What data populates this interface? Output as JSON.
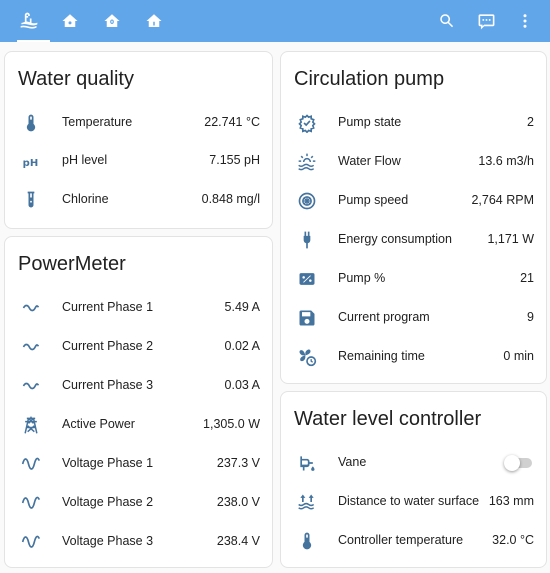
{
  "colors": {
    "header": "#62a6ea",
    "icon": "#44739e",
    "card_bg": "#ffffff",
    "page_bg": "#fafafa"
  },
  "header": {
    "tabs": [
      {
        "icon": "pool-icon",
        "active": true
      },
      {
        "icon": "home-icon",
        "active": false
      },
      {
        "icon": "home-circle-icon",
        "active": false
      },
      {
        "icon": "home-outline-icon",
        "active": false
      }
    ],
    "actions": [
      "search-icon",
      "assist-icon",
      "menu-icon"
    ]
  },
  "water_quality": {
    "title": "Water quality",
    "rows": [
      {
        "icon": "thermometer-icon",
        "label": "Temperature",
        "value": "22.741 °C"
      },
      {
        "icon": "ph-icon",
        "label": "pH level",
        "value": "7.155 pH"
      },
      {
        "icon": "test-tube-icon",
        "label": "Chlorine",
        "value": "0.848 mg/l"
      }
    ]
  },
  "power_meter": {
    "title": "PowerMeter",
    "rows": [
      {
        "icon": "current-ac-icon",
        "label": "Current Phase 1",
        "value": "5.49 A"
      },
      {
        "icon": "current-ac-icon",
        "label": "Current Phase 2",
        "value": "0.02 A"
      },
      {
        "icon": "current-ac-icon",
        "label": "Current Phase 3",
        "value": "0.03 A"
      },
      {
        "icon": "transmission-tower-icon",
        "label": "Active Power",
        "value": "1,305.0 W"
      },
      {
        "icon": "sine-wave-icon",
        "label": "Voltage Phase 1",
        "value": "237.3 V"
      },
      {
        "icon": "sine-wave-icon",
        "label": "Voltage Phase 2",
        "value": "238.0 V"
      },
      {
        "icon": "sine-wave-icon",
        "label": "Voltage Phase 3",
        "value": "238.4 V"
      }
    ]
  },
  "circulation_pump": {
    "title": "Circulation pump",
    "rows": [
      {
        "icon": "gauge-check-icon",
        "label": "Pump state",
        "value": "2"
      },
      {
        "icon": "water-sun-icon",
        "label": "Water Flow",
        "value": "13.6 m3/h"
      },
      {
        "icon": "pump-icon",
        "label": "Pump speed",
        "value": "2,764 RPM"
      },
      {
        "icon": "power-plug-icon",
        "label": "Energy consumption",
        "value": "1,171 W"
      },
      {
        "icon": "battery-percent-icon",
        "label": "Pump %",
        "value": "21"
      },
      {
        "icon": "content-save-icon",
        "label": "Current program",
        "value": "9"
      },
      {
        "icon": "fan-clock-icon",
        "label": "Remaining time",
        "value": "0 min"
      }
    ]
  },
  "water_level": {
    "title": "Water level controller",
    "rows": [
      {
        "icon": "water-pump-icon",
        "label": "Vane",
        "value": "off"
      },
      {
        "icon": "arrow-up-water-icon",
        "label": "Distance to water surface",
        "value": "163 mm"
      },
      {
        "icon": "thermometer-icon",
        "label": "Controller temperature",
        "value": "32.0 °C"
      }
    ]
  }
}
